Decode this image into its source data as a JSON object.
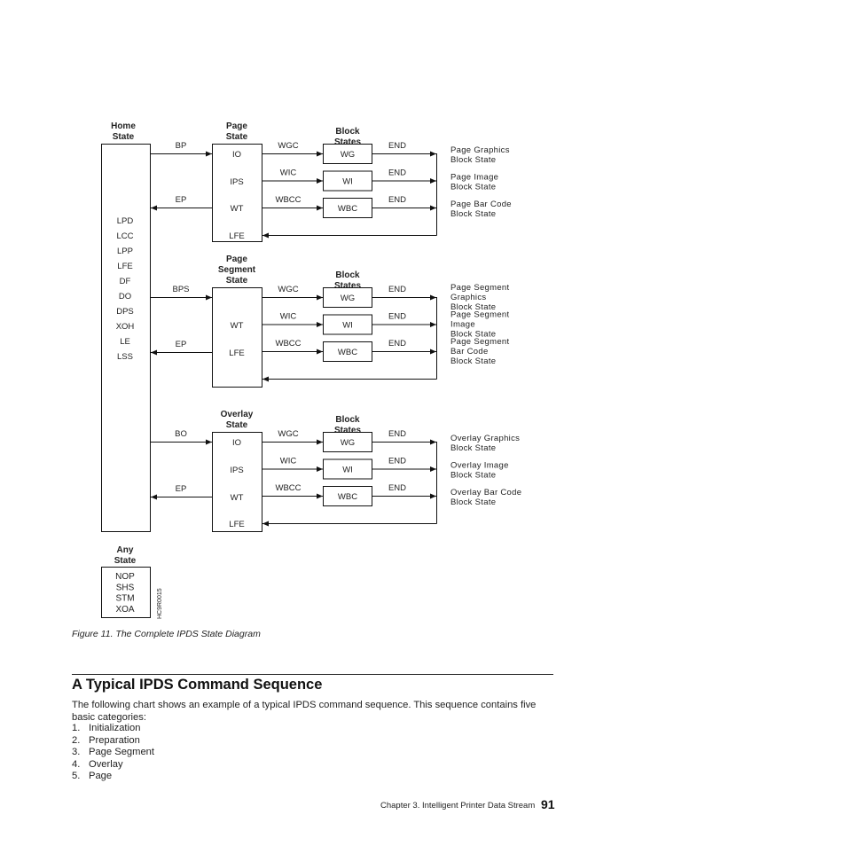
{
  "diagram": {
    "home": {
      "title_line1": "Home",
      "title_line2": "State",
      "commands": [
        "LPD",
        "LCC",
        "LPP",
        "LFE",
        "DF",
        "DO",
        "DPS",
        "XOH",
        "LE",
        "LSS"
      ]
    },
    "page": {
      "title_line1": "Page",
      "title_line2": "State",
      "enter_label": "BP",
      "exit_label": "EP",
      "items": [
        "IO",
        "IPS",
        "WT",
        "LFE"
      ]
    },
    "page_segment": {
      "title_line1": "Page",
      "title_line2": "Segment",
      "title_line3": "State",
      "enter_label": "BPS",
      "exit_label": "EP",
      "items": [
        "WT",
        "LFE"
      ]
    },
    "overlay": {
      "title_line1": "Overlay",
      "title_line2": "State",
      "enter_label": "BO",
      "exit_label": "EP",
      "items": [
        "IO",
        "IPS",
        "WT",
        "LFE"
      ]
    },
    "block_states_title_line1": "Block",
    "block_states_title_line2": "States",
    "block_commands": [
      "WGC",
      "WIC",
      "WBCC"
    ],
    "block_boxes": [
      "WG",
      "WI",
      "WBC"
    ],
    "end_label": "END",
    "page_block_descriptions": [
      [
        "Page Graphics",
        "Block State"
      ],
      [
        "Page Image",
        "Block State"
      ],
      [
        "Page Bar Code",
        "Block State"
      ]
    ],
    "segment_block_descriptions": [
      [
        "Page Segment",
        "Graphics",
        "Block State"
      ],
      [
        "Page Segment",
        "Image",
        "Block State"
      ],
      [
        "Page Segment",
        "Bar Code",
        "Block State"
      ]
    ],
    "overlay_block_descriptions": [
      [
        "Overlay Graphics",
        "Block State"
      ],
      [
        "Overlay Image",
        "Block State"
      ],
      [
        "Overlay Bar Code",
        "Block State"
      ]
    ],
    "any": {
      "title_line1": "Any",
      "title_line2": "State",
      "commands": [
        "NOP",
        "SHS",
        "STM",
        "XOA"
      ]
    },
    "figure_id": "HC9R0015"
  },
  "caption": "Figure 11. The Complete IPDS State Diagram",
  "section": {
    "heading": "A Typical IPDS Command Sequence",
    "paragraph": "The following chart shows an example of a typical IPDS command sequence. This sequence contains five basic categories:",
    "list": [
      {
        "num": "1.",
        "text": "Initialization"
      },
      {
        "num": "2.",
        "text": "Preparation"
      },
      {
        "num": "3.",
        "text": "Page Segment"
      },
      {
        "num": "4.",
        "text": "Overlay"
      },
      {
        "num": "5.",
        "text": "Page"
      }
    ]
  },
  "footer": {
    "chapter": "Chapter 3. Intelligent Printer Data Stream",
    "page_number": "91"
  }
}
